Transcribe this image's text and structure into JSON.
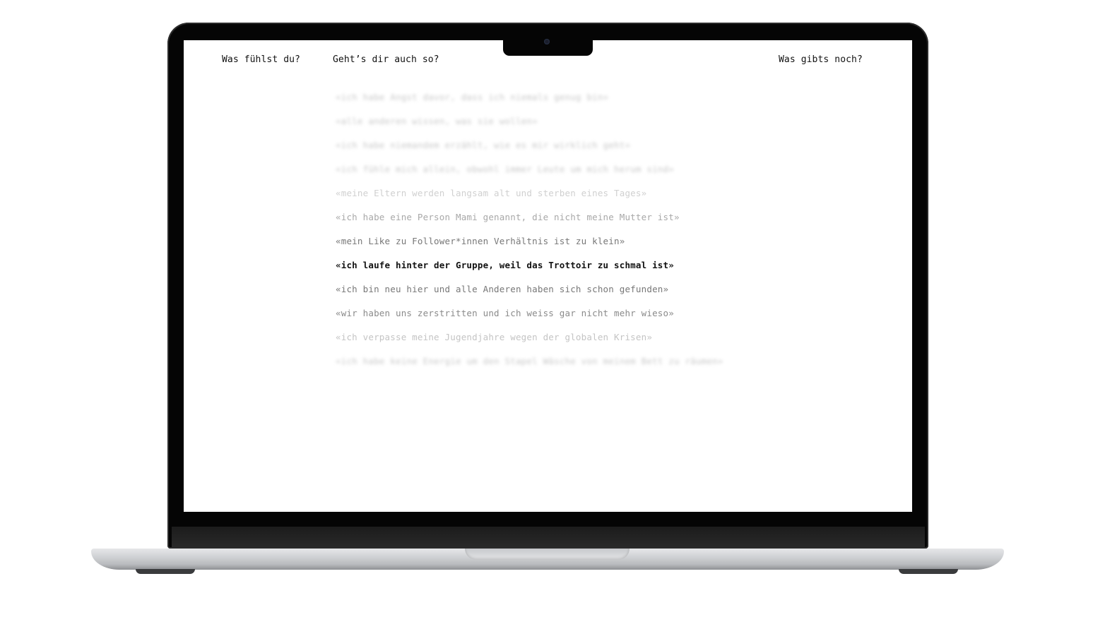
{
  "nav": {
    "feel_label": "Was fühlst du?",
    "same_label": "Geht’s dir auch so?",
    "more_label": "Was gibts noch?"
  },
  "quotes": [
    "«ich habe Angst davor, dass ich niemals genug bin»",
    "«alle anderen wissen, was sie wollen»",
    "«ich habe niemandem erzählt, wie es mir wirklich geht»",
    "«ich fühle mich allein, obwohl immer Leute um mich herum sind»",
    "«meine Eltern werden langsam alt und sterben eines Tages»",
    "«ich habe eine Person Mami genannt, die nicht meine Mutter ist»",
    "«mein Like zu Follower*innen Verhältnis ist zu klein»",
    "«ich laufe hinter der Gruppe, weil das Trottoir zu schmal ist»",
    "«ich bin neu hier und alle Anderen haben sich schon gefunden»",
    "«wir haben uns zerstritten und ich weiss gar nicht mehr wieso»",
    "«ich verpasse meine Jugendjahre wegen der globalen Krisen»",
    "«ich habe keine Energie um den Stapel Wäsche von meinem Bett zu räumen»"
  ]
}
